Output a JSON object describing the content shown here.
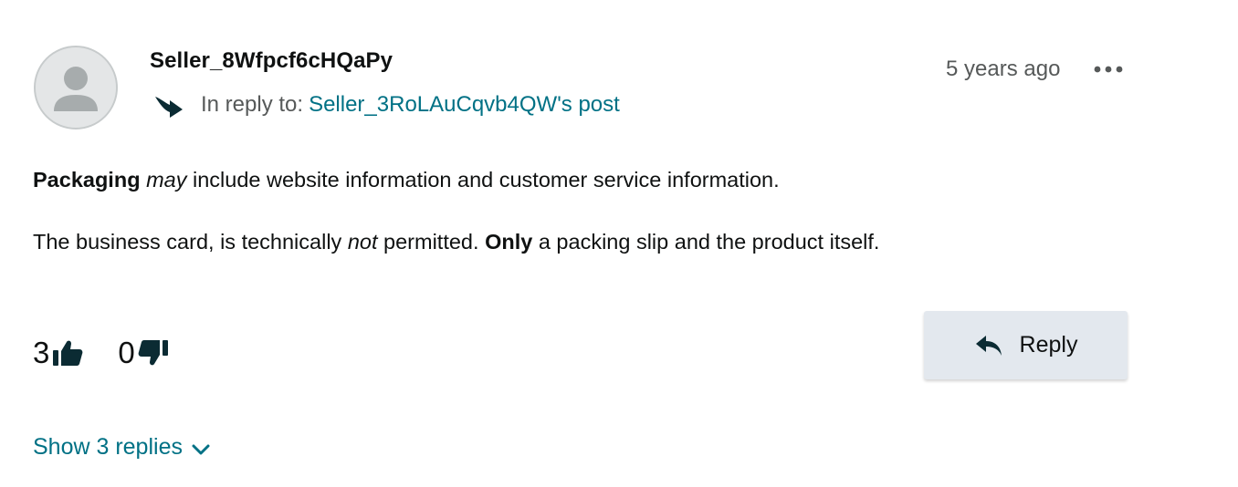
{
  "post": {
    "author": "Seller_8Wfpcf6cHQaPy",
    "reply_to_label": "In reply to:",
    "reply_to_link": "Seller_3RoLAuCqvb4QW's post",
    "timestamp": "5 years ago",
    "body": {
      "p1": {
        "bold1": "Packaging",
        "italic1": "may",
        "rest": "include website information and customer service information."
      },
      "p2": {
        "start": "The business card, is technically",
        "italic1": "not",
        "mid": "permitted.",
        "bold1": "Only",
        "rest": "a packing slip and the product itself."
      }
    },
    "votes": {
      "up": "3",
      "down": "0"
    },
    "reply_button_label": "Reply",
    "show_replies_label": "Show 3 replies"
  },
  "colors": {
    "link": "#007185",
    "text": "#0f1111",
    "muted": "#565959",
    "icon_dark": "#0b2b33",
    "reply_button_bg": "#e3e8ee",
    "avatar_bg": "#d5d9d9",
    "avatar_figure": "#a7acad"
  },
  "icons": {
    "reply_to": "curved-arrow-right-icon",
    "more": "more-horizontal-icon",
    "upvote": "thumbs-up-icon",
    "downvote": "thumbs-down-icon",
    "reply": "reply-arrow-icon",
    "expand": "chevron-down-icon",
    "avatar": "user-silhouette-icon"
  }
}
